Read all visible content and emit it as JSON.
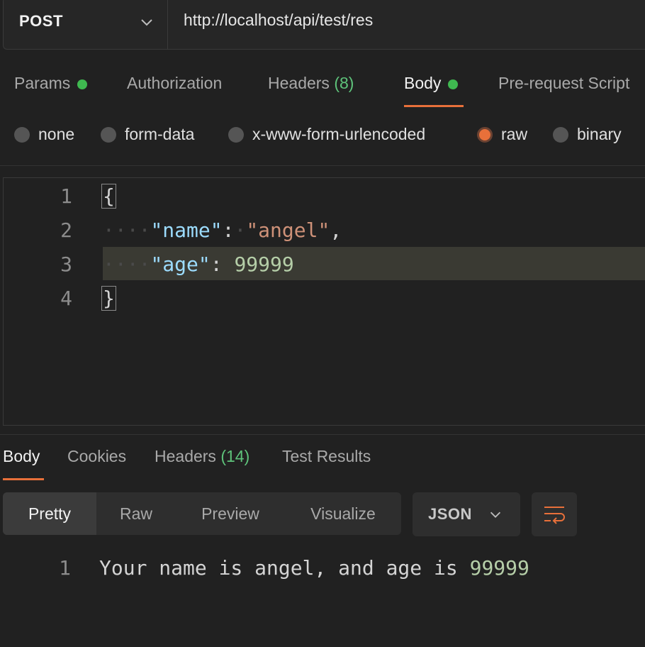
{
  "request": {
    "method": "POST",
    "url": "http://localhost/api/test/res"
  },
  "request_tabs": [
    {
      "label": "Params",
      "indicator": "green-dot"
    },
    {
      "label": "Authorization"
    },
    {
      "label": "Headers",
      "count": "(8)"
    },
    {
      "label": "Body",
      "indicator": "green-dot",
      "active": true
    },
    {
      "label": "Pre-request Script"
    }
  ],
  "body_types": [
    {
      "label": "none",
      "selected": false
    },
    {
      "label": "form-data",
      "selected": false
    },
    {
      "label": "x-www-form-urlencoded",
      "selected": false
    },
    {
      "label": "raw",
      "selected": true
    },
    {
      "label": "binary",
      "selected": false
    }
  ],
  "editor": {
    "line_numbers": [
      "1",
      "2",
      "3",
      "4"
    ],
    "open_brace": "{",
    "close_brace": "}",
    "indent_dots": "····",
    "key_name": "\"name\"",
    "value_name": "\"angel\"",
    "key_age": "\"age\"",
    "value_age": "99999",
    "colon": ":",
    "comma": ","
  },
  "response_tabs": [
    {
      "label": "Body",
      "active": true
    },
    {
      "label": "Cookies"
    },
    {
      "label": "Headers",
      "count": "(14)"
    },
    {
      "label": "Test Results"
    }
  ],
  "view_modes": [
    "Pretty",
    "Raw",
    "Preview",
    "Visualize"
  ],
  "format": "JSON",
  "response": {
    "line_number": "1",
    "text": "Your name is angel, and age is ",
    "number": "99999"
  },
  "colors": {
    "accent": "#e8703a",
    "green": "#3fb950",
    "background": "#212121"
  }
}
